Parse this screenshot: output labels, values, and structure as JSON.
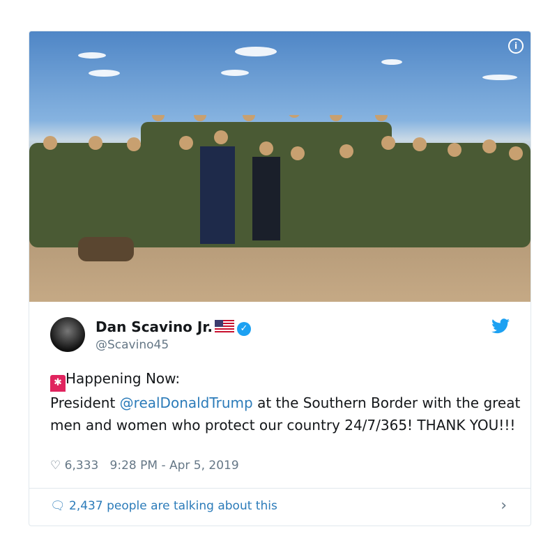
{
  "tweet": {
    "author_name": "Dan Scavino Jr.",
    "author_handle": "@Scavino45",
    "text_line1": "Happening Now:",
    "text_prefix": "President ",
    "mention": "@realDonaldTrump",
    "text_rest": " at the Southern Border with the great men and women who protect our country 24/7/365! THANK YOU!!!",
    "likes": "6,333",
    "timestamp": "9:28 PM - Apr 5, 2019",
    "conversation": "2,437 people are talking about this"
  },
  "colors": {
    "accent": "#1da1f2",
    "link": "#2b7bb9",
    "muted": "#657786"
  }
}
